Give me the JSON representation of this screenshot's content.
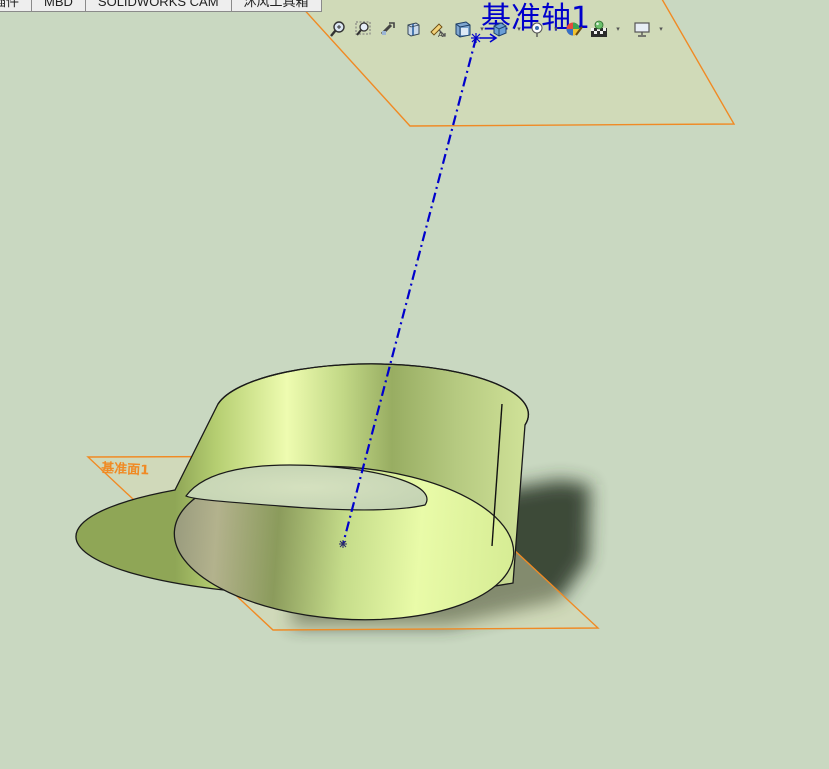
{
  "command_tabs": [
    {
      "label": "插件"
    },
    {
      "label": "MBD"
    },
    {
      "label": "SOLIDWORKS CAM"
    },
    {
      "label": "沐风工具箱"
    }
  ],
  "view_toolbar": {
    "icons": [
      {
        "name": "zoom-to-fit-icon"
      },
      {
        "name": "zoom-to-area-icon"
      },
      {
        "name": "previous-view-icon"
      },
      {
        "name": "section-view-icon"
      },
      {
        "name": "dynamic-annotation-icon"
      },
      {
        "name": "view-orientation-icon"
      },
      {
        "name": "display-style-icon"
      },
      {
        "name": "hide-show-items-icon"
      },
      {
        "name": "edit-appearance-icon"
      },
      {
        "name": "apply-scene-icon"
      },
      {
        "name": "view-settings-icon"
      }
    ]
  },
  "scene": {
    "axis_label": "基准轴1",
    "plane_label": "基准面1",
    "colors": {
      "background": "#c9d8c1",
      "plane_edge": "#f08a24",
      "axis": "#0000cc",
      "part_light": "#e4f7a0",
      "part_dark": "#8aa050"
    }
  }
}
